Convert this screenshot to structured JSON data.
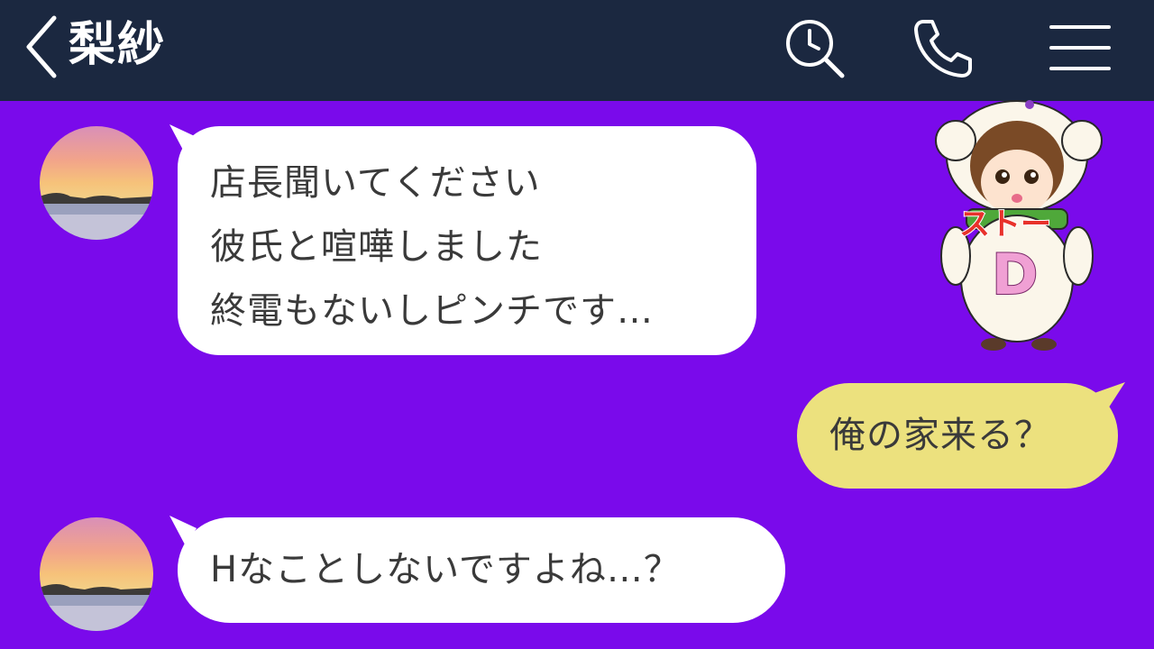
{
  "header": {
    "title": "梨紗",
    "back_icon": "chevron-left-icon",
    "search_icon": "search-clock-icon",
    "call_icon": "phone-icon",
    "menu_icon": "hamburger-menu-icon",
    "background": "#1b2840"
  },
  "chat": {
    "background": "#7a0aeb",
    "incoming_bubble_color": "#ffffff",
    "outgoing_bubble_color": "#ece17e",
    "messages": [
      {
        "direction": "incoming",
        "lines": [
          "店長聞いてください",
          "彼氏と喧嘩しました",
          "終電もないしピンチです…"
        ]
      },
      {
        "direction": "outgoing",
        "lines": [
          "俺の家来る？"
        ]
      },
      {
        "direction": "incoming",
        "lines": [
          "Hなことしないですよね…？"
        ]
      }
    ]
  },
  "sticker": {
    "text_top": "ストー",
    "text_big": "D"
  }
}
